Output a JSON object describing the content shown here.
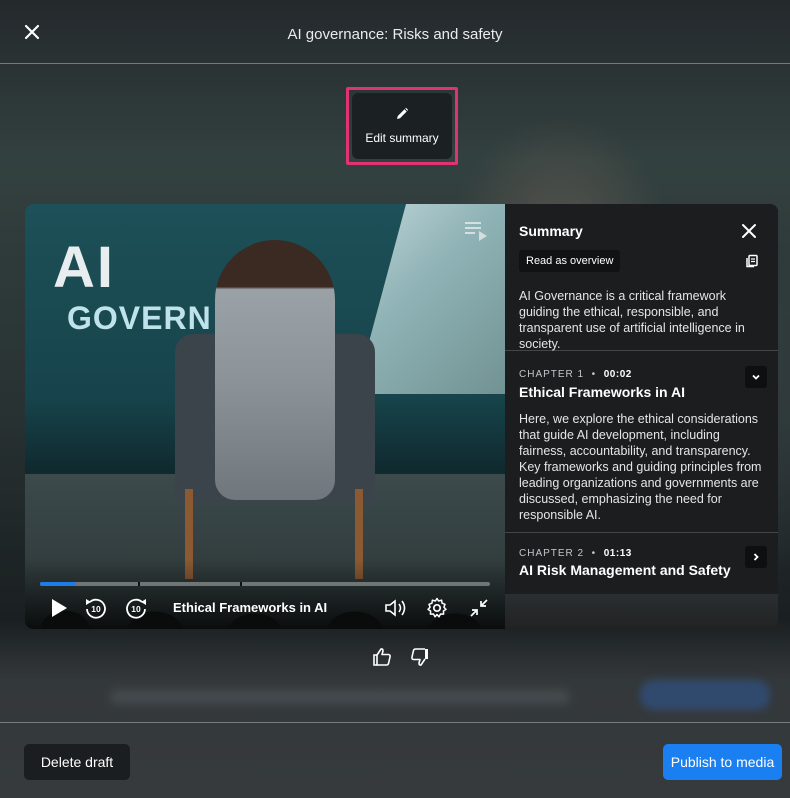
{
  "header": {
    "title": "AI governance: Risks and safety",
    "close_icon": "close-icon"
  },
  "edit_summary": {
    "label": "Edit summary",
    "icon": "pencil-icon",
    "highlight_color": "#e0336f"
  },
  "video": {
    "stage_text_1": "AI",
    "stage_text_2": "GOVERN",
    "progress_fraction": 0.08,
    "current_chapter": "Ethical Frameworks in AI",
    "controls": [
      "play-icon",
      "rewind-10-icon",
      "forward-10-icon",
      "volume-icon",
      "settings-gear-icon",
      "collapse-icon"
    ],
    "rewind_label": "10",
    "forward_label": "10"
  },
  "summary": {
    "title": "Summary",
    "overview_chip": "Read as overview",
    "overview_text": "AI Governance is a critical framework guiding the ethical, responsible, and transparent use of artificial intelligence in society.",
    "chapters": [
      {
        "label": "CHAPTER 1",
        "time": "00:02",
        "title": "Ethical Frameworks in AI",
        "body": "Here, we explore the ethical considerations that guide AI development, including fairness, accountability, and transparency. Key frameworks and guiding principles from leading organizations and governments are discussed, emphasizing the need for responsible AI.",
        "expanded": true
      },
      {
        "label": "CHAPTER 2",
        "time": "01:13",
        "title": "AI Risk Management and Safety",
        "expanded": false
      }
    ]
  },
  "feedback": {
    "like_icon": "thumbs-up-icon",
    "dislike_icon": "thumbs-down-icon"
  },
  "footer": {
    "delete_label": "Delete draft",
    "publish_label": "Publish to media",
    "publish_color": "#1a7ff0"
  }
}
